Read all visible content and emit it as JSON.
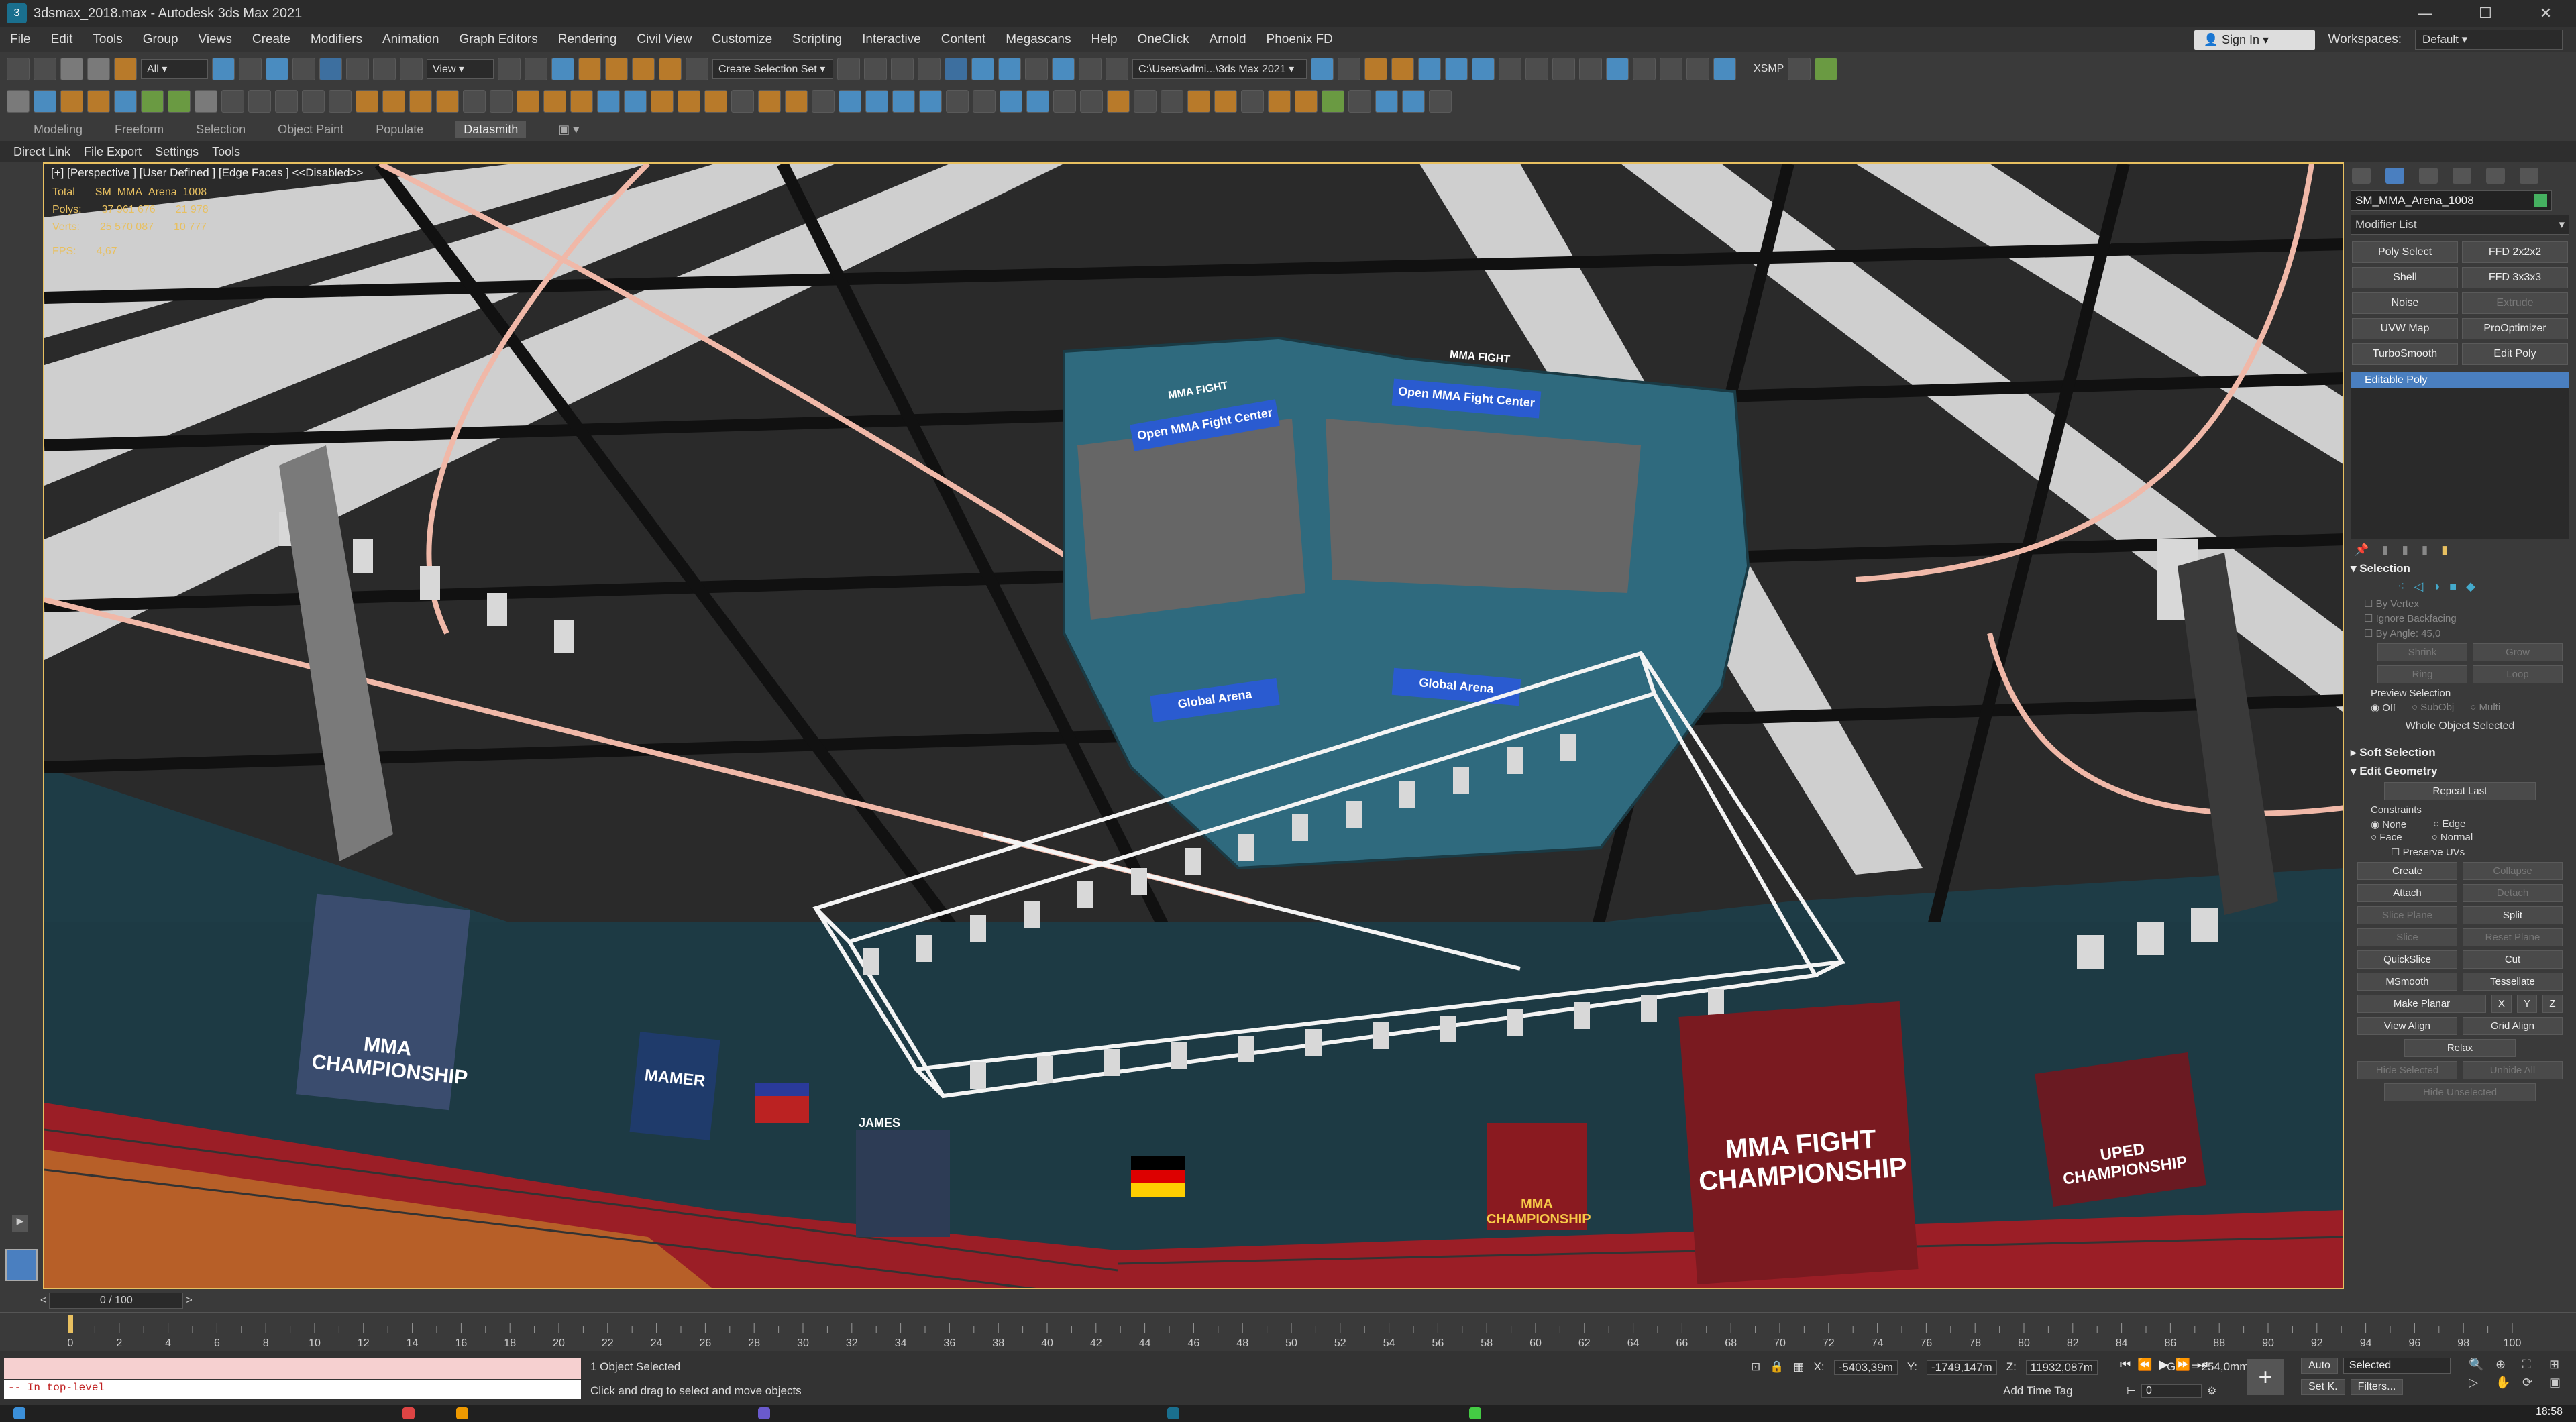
{
  "window": {
    "title": "3dsmax_2018.max - Autodesk 3ds Max 2021",
    "app_icon": "3ds-max-icon"
  },
  "menu": [
    "File",
    "Edit",
    "Tools",
    "Group",
    "Views",
    "Create",
    "Modifiers",
    "Animation",
    "Graph Editors",
    "Rendering",
    "Civil View",
    "Customize",
    "Scripting",
    "Interactive",
    "Content",
    "Megascans",
    "Help",
    "OneClick",
    "Arnold",
    "Phoenix FD"
  ],
  "account": {
    "signin": "Sign In",
    "workspaces_label": "Workspaces:",
    "workspace": "Default"
  },
  "toolbar": {
    "selection_filter": "All",
    "ref_coord": "View",
    "selection_set": "Create Selection Set",
    "project_path": "C:\\Users\\admi...\\3ds Max 2021",
    "xsmp": "XSMP"
  },
  "ribbon": {
    "tabs": [
      "Modeling",
      "Freeform",
      "Selection",
      "Object Paint",
      "Populate",
      "Datasmith"
    ],
    "active": "Datasmith",
    "sub_tabs": [
      "Direct Link",
      "File Export",
      "Settings",
      "Tools"
    ]
  },
  "viewport": {
    "label": "[+] [Perspective ] [User Defined ] [Edge Faces ] <<Disabled>>",
    "stats": {
      "total_label": "Total",
      "object_name": "SM_MMA_Arena_1008",
      "polys_label": "Polys:",
      "polys_total": "37 961 676",
      "polys_sel": "21 978",
      "verts_label": "Verts:",
      "verts_total": "25 570 087",
      "verts_sel": "10 777",
      "fps_label": "FPS:",
      "fps": "4,67"
    },
    "signs": [
      "Open MMA Fight Center",
      "Open MMA Fight Center",
      "Global Arena",
      "Global Arena",
      "MMA FIGHT",
      "MMA FIGHT"
    ],
    "posters": [
      "MMA CHAMPIONSHIP",
      "MMA FIGHT CHAMPIONSHIP",
      "MMA CHAMPIONSHIP",
      "UPED CHAMPIONSHIP",
      "MAMER",
      "JAMES"
    ]
  },
  "command_panel": {
    "object_name": "SM_MMA_Arena_1008",
    "modifier_list": "Modifier List",
    "modifiers": [
      "Poly Select",
      "FFD 2x2x2",
      "Shell",
      "FFD 3x3x3",
      "Noise",
      "Extrude",
      "UVW Map",
      "ProOptimizer",
      "TurboSmooth",
      "Edit Poly"
    ],
    "stack_item": "Editable Poly",
    "selection": {
      "title": "Selection",
      "by_vertex": "By Vertex",
      "ignore_backfacing": "Ignore Backfacing",
      "by_angle": "By Angle:",
      "angle": "45,0",
      "shrink": "Shrink",
      "grow": "Grow",
      "ring": "Ring",
      "loop": "Loop",
      "preview": "Preview Selection",
      "off": "Off",
      "subobj": "SubObj",
      "multi": "Multi",
      "whole": "Whole Object Selected"
    },
    "soft_selection": "Soft Selection",
    "edit_geometry": {
      "title": "Edit Geometry",
      "repeat_last": "Repeat Last",
      "constraints": "Constraints",
      "none": "None",
      "edge": "Edge",
      "face": "Face",
      "normal": "Normal",
      "preserve_uvs": "Preserve UVs",
      "create": "Create",
      "collapse": "Collapse",
      "attach": "Attach",
      "detach": "Detach",
      "slice_plane": "Slice Plane",
      "split": "Split",
      "slice": "Slice",
      "reset_plane": "Reset Plane",
      "quickslice": "QuickSlice",
      "cut": "Cut",
      "msmooth": "MSmooth",
      "tessellate": "Tessellate",
      "make_planar": "Make Planar",
      "x": "X",
      "y": "Y",
      "z": "Z",
      "view_align": "View Align",
      "grid_align": "Grid Align",
      "relax": "Relax",
      "hide_selected": "Hide Selected",
      "unhide_all": "Unhide All",
      "hide_unselected": "Hide Unselected"
    }
  },
  "timeline": {
    "frame": "0 / 100",
    "ticks": [
      "0",
      "2",
      "4",
      "6",
      "8",
      "10",
      "12",
      "14",
      "16",
      "18",
      "20",
      "22",
      "24",
      "26",
      "28",
      "30",
      "32",
      "34",
      "36",
      "38",
      "40",
      "42",
      "44",
      "46",
      "48",
      "50",
      "52",
      "54",
      "56",
      "58",
      "60",
      "62",
      "64",
      "66",
      "68",
      "70",
      "72",
      "74",
      "76",
      "78",
      "80",
      "82",
      "84",
      "86",
      "88",
      "90",
      "92",
      "94",
      "96",
      "98",
      "100"
    ]
  },
  "status": {
    "maxscript": "-- In top-level",
    "selected": "1 Object Selected",
    "prompt": "Click and drag to select and move objects",
    "x_label": "X:",
    "x": "-5403,39m",
    "y_label": "Y:",
    "y": "-1749,147m",
    "z_label": "Z:",
    "z": "11932,087m",
    "grid": "Grid = 254,0mm",
    "add_time_tag": "Add Time Tag",
    "auto": "Auto",
    "set_k": "Set K.",
    "selected_set": "Selected",
    "filters": "Filters...",
    "frame_field": "0",
    "clock": "18:58"
  }
}
